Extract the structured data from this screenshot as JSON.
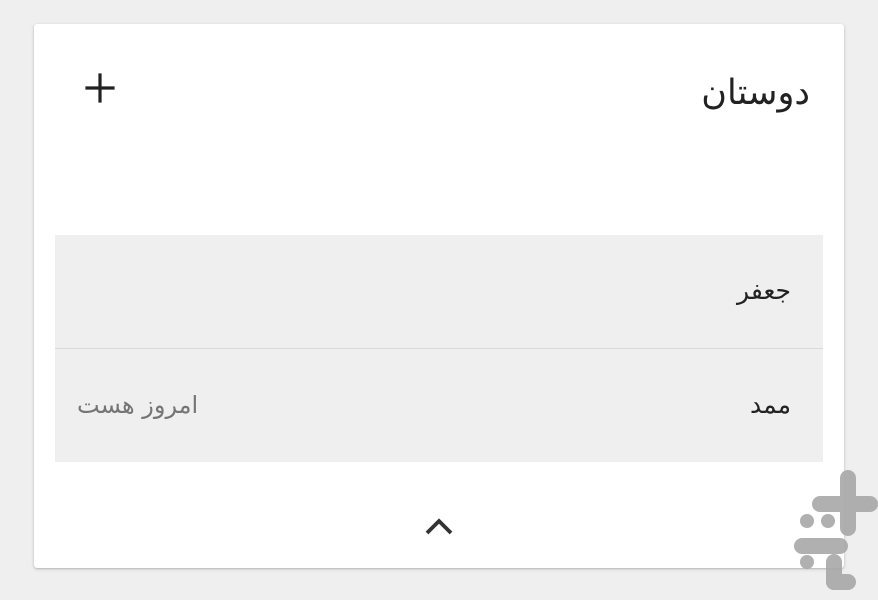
{
  "header": {
    "title": "دوستان",
    "add_icon": "plus-icon"
  },
  "friends": [
    {
      "name": "جعفر",
      "status": ""
    },
    {
      "name": "ممد",
      "status": "امروز هست"
    }
  ],
  "footer": {
    "collapse_icon": "chevron-up-icon"
  },
  "watermark": {
    "logo_name": "app-store-logo"
  }
}
